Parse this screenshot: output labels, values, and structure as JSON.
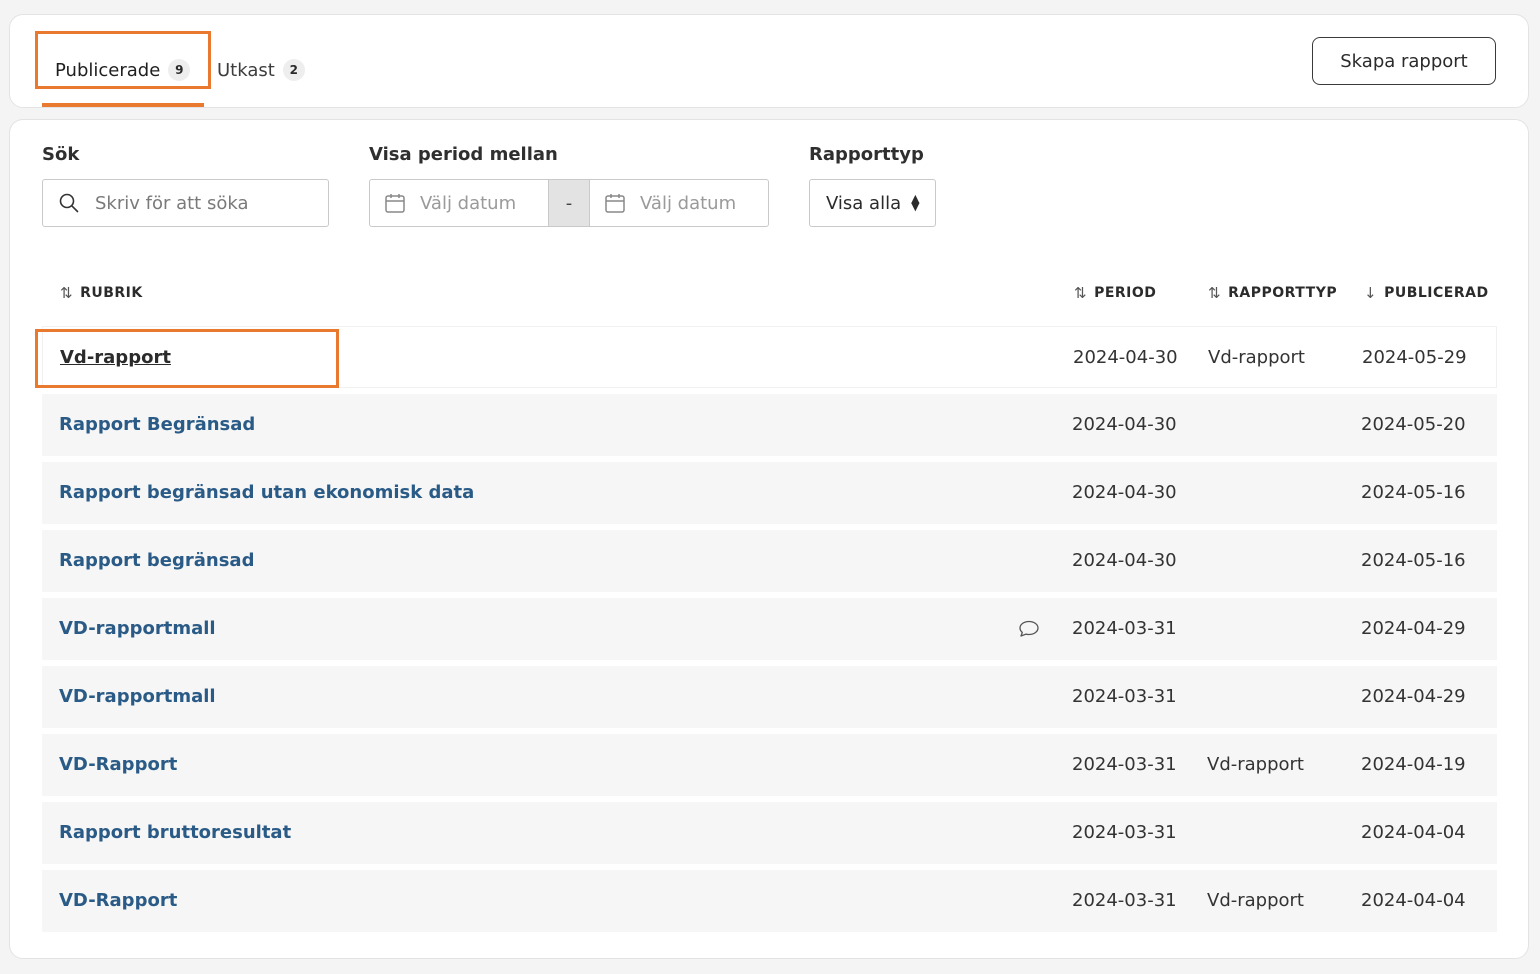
{
  "tabs": [
    {
      "label": "Publicerade",
      "count": "9"
    },
    {
      "label": "Utkast",
      "count": "2"
    }
  ],
  "create_button": "Skapa rapport",
  "filters": {
    "search_label": "Sök",
    "search_placeholder": "Skriv för att söka",
    "period_label": "Visa period mellan",
    "date_placeholder": "Välj datum",
    "date_separator": "-",
    "type_label": "Rapporttyp",
    "type_value": "Visa alla"
  },
  "columns": {
    "title": "RUBRIK",
    "period": "PERIOD",
    "type": "RAPPORTTYP",
    "published": "PUBLICERAD"
  },
  "rows": [
    {
      "title": "Vd-rapport",
      "period": "2024-04-30",
      "type": "Vd-rapport",
      "published": "2024-05-29"
    },
    {
      "title": "Rapport Begränsad",
      "period": "2024-04-30",
      "type": "",
      "published": "2024-05-20"
    },
    {
      "title": "Rapport begränsad utan ekonomisk data",
      "period": "2024-04-30",
      "type": "",
      "published": "2024-05-16"
    },
    {
      "title": "Rapport begränsad",
      "period": "2024-04-30",
      "type": "",
      "published": "2024-05-16"
    },
    {
      "title": "VD-rapportmall",
      "period": "2024-03-31",
      "type": "",
      "published": "2024-04-29",
      "has_comment": true
    },
    {
      "title": "VD-rapportmall",
      "period": "2024-03-31",
      "type": "",
      "published": "2024-04-29"
    },
    {
      "title": "VD-Rapport",
      "period": "2024-03-31",
      "type": "Vd-rapport",
      "published": "2024-04-19"
    },
    {
      "title": "Rapport bruttoresultat",
      "period": "2024-03-31",
      "type": "",
      "published": "2024-04-04"
    },
    {
      "title": "VD-Rapport",
      "period": "2024-03-31",
      "type": "Vd-rapport",
      "published": "2024-04-04"
    }
  ],
  "accent_color": "#e8792f",
  "link_color": "#2a5a86"
}
